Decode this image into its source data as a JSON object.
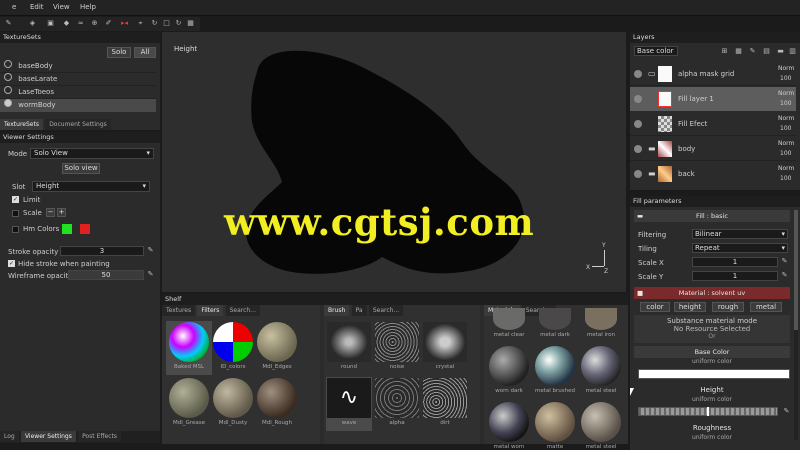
{
  "menu": {
    "items": [
      "e",
      "Edit",
      "View",
      "Help"
    ]
  },
  "texture_sets": {
    "title": "TextureSets",
    "solo_label": "Solo",
    "all_label": "All",
    "items": [
      "baseBody",
      "baseLarate",
      "LaseToeos",
      "wormBody"
    ],
    "tabs": [
      "TextureSets",
      "Document Settings"
    ]
  },
  "viewer_settings": {
    "title": "Viewer Settings",
    "mode_label": "Mode",
    "mode_value": "Solo View",
    "solo_view_button": "Solo view",
    "slot_label": "Slot",
    "slot_value": "Height",
    "limit_label": "Limit",
    "scale_label": "Scale",
    "colors_label": "Hm Colors",
    "stroke_opacity_label": "Stroke opacity",
    "stroke_opacity_value": "3",
    "hide_stroke_label": "Hide stroke when painting",
    "wireframe_opacity_label": "Wireframe opacity",
    "wireframe_opacity_value": "50",
    "bottom_tabs": [
      "Log",
      "Viewer Settings",
      "Post Effects"
    ]
  },
  "viewport": {
    "label": "Height",
    "watermark": "www.cgtsj.com",
    "axis": {
      "y": "Y",
      "x": "X",
      "z": "Z"
    }
  },
  "shelf": {
    "title": "Shelf",
    "section1_tabs": [
      "Textures",
      "Filters",
      "Search..."
    ],
    "section1_items": [
      "Baked MSL",
      "ID_colors",
      "Mdl_Edges",
      "Mdl_Grease",
      "Mdl_Dusty",
      "Mdl_Rough"
    ],
    "section2_tabs": [
      "Brush",
      "Pa",
      "Search..."
    ],
    "section2_items": [
      "round",
      "noise",
      "crystal",
      "wave",
      "alpha",
      "dirt"
    ],
    "section3_tabs": [
      "Materials",
      "Search..."
    ],
    "section3_items": [
      "metal clear",
      "metal dark",
      "metal iron",
      "worn dark",
      "metal brushed",
      "metal steel",
      "metal worn",
      "matte",
      "metal steel"
    ]
  },
  "layers": {
    "title": "Layers",
    "blend_mode": "Base color",
    "items": [
      {
        "name": "alpha mask grid",
        "blend": "Norm",
        "opacity": "100"
      },
      {
        "name": "Fill layer 1",
        "blend": "Norm",
        "opacity": "100"
      },
      {
        "name": "Fill Efect",
        "blend": "Norm",
        "opacity": "100"
      },
      {
        "name": "body",
        "blend": "Norm",
        "opacity": "100"
      },
      {
        "name": "back",
        "blend": "Norm",
        "opacity": "100"
      }
    ]
  },
  "fill_params": {
    "title": "Fill parameters",
    "section_title": "Fill : basic",
    "filtering_label": "Filtering",
    "filtering_value": "Bilinear",
    "tiling_label": "Tiling",
    "tiling_value": "Repeat",
    "scale_x_label": "Scale X",
    "scale_x_value": "1",
    "scale_y_label": "Scale Y",
    "scale_y_value": "1",
    "material_title": "Material : solvent uv",
    "channels": [
      "color",
      "height",
      "rough",
      "metal"
    ],
    "substance_label": "Substance material mode",
    "no_resource": "No Resource Selected",
    "or_text": "Or",
    "base_color_label": "Base Color",
    "uniform_color": "uniform color",
    "height_label": "Height",
    "uniform_color2": "uniform color",
    "roughness_label": "Roughness",
    "uniform_color3": "uniform color"
  },
  "colors": {
    "accent_red": "#e32020",
    "accent_green": "#22e022",
    "watermark": "#f1ee22",
    "material_bar": "#7a2a2a",
    "selected_layer": "#5d5d5d"
  }
}
